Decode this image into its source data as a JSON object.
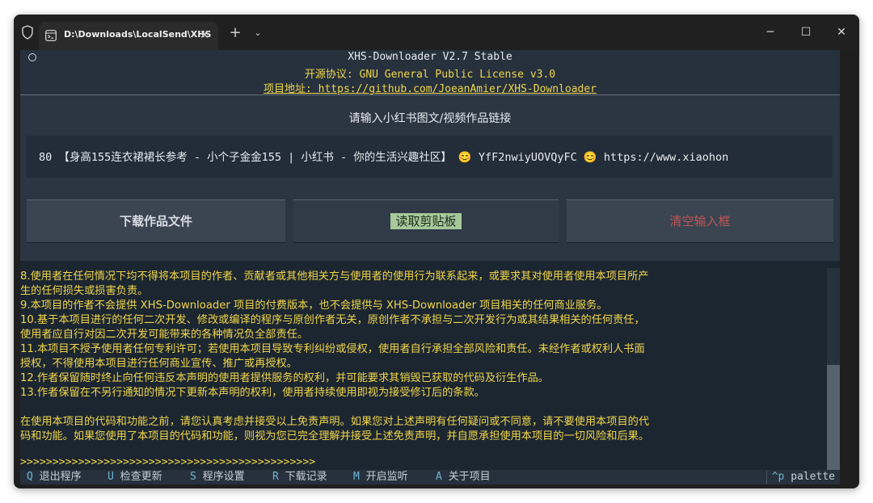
{
  "tab": {
    "title": "D:\\Downloads\\LocalSend\\XHS"
  },
  "window_controls": {
    "minimize": "─",
    "maximize": "☐",
    "close": "✕"
  },
  "header": {
    "line1": "XHS-Downloader V2.7 Stable",
    "license_label": "开源协议: ",
    "license_value": "GNU General Public License v3.0",
    "address_label": "项目地址: ",
    "address_value": "https://github.com/JoeanAmier/XHS-Downloader"
  },
  "main": {
    "prompt": "请输入小红书图文/视频作品链接",
    "input_value": "80 【身高155连衣裙裙长参考 - 小个子金金155 | 小红书 - 你的生活兴趣社区】 😊 YfF2nwiyUOVQyFC 😊 https://www.xiaohon",
    "buttons": {
      "download": "下载作品文件",
      "read_clipboard": "读取剪贴板",
      "clear_input": "清空输入框"
    }
  },
  "log": [
    "8.使用者在任何情况下均不得将本项目的作者、贡献者或其他相关方与使用者的使用行为联系起来，或要求其对使用者使用本项目所产",
    "生的任何损失或损害负责。",
    "9.本项目的作者不会提供 XHS-Downloader 项目的付费版本，也不会提供与 XHS-Downloader 项目相关的任何商业服务。",
    "10.基于本项目进行的任何二次开发、修改或编译的程序与原创作者无关，原创作者不承担与二次开发行为或其结果相关的任何责任，",
    "使用者应自行对因二次开发可能带来的各种情况负全部责任。",
    "11.本项目不授予使用者任何专利许可；若使用本项目导致专利纠纷或侵权，使用者自行承担全部风险和责任。未经作者或权利人书面",
    "授权，不得使用本项目进行任何商业宣传、推广或再授权。",
    "12.作者保留随时终止向任何违反本声明的使用者提供服务的权利，并可能要求其销毁已获取的代码及衍生作品。",
    "13.作者保留在不另行通知的情况下更新本声明的权利，使用者持续使用即视为接受修订后的条款。",
    "",
    "在使用本项目的代码和功能之前，请您认真考虑并接受以上免责声明。如果您对上述声明有任何疑问或不同意，请不要使用本项目的代",
    "码和功能。如果您使用了本项目的代码和功能，则视为您已完全理解并接受上述免责声明，并自愿承担使用本项目的一切风险和后果。",
    "",
    ">>>>>>>>>>>>>>>>>>>>>>>>>>>>>>>>>>>>>>>>>>>>>>"
  ],
  "footer": {
    "items": [
      {
        "key": "Q",
        "label": "退出程序"
      },
      {
        "key": "U",
        "label": "检查更新"
      },
      {
        "key": "S",
        "label": "程序设置"
      },
      {
        "key": "R",
        "label": "下载记录"
      },
      {
        "key": "M",
        "label": "开启监听"
      },
      {
        "key": "A",
        "label": "关于项目"
      }
    ],
    "palette_key": "^p",
    "palette_label": "palette"
  },
  "colors": {
    "accent_yellow": "#f0d64a",
    "footer_key": "#6fb6d6",
    "clear_red": "#c25454",
    "clipboard_green": "#a6c89a"
  }
}
